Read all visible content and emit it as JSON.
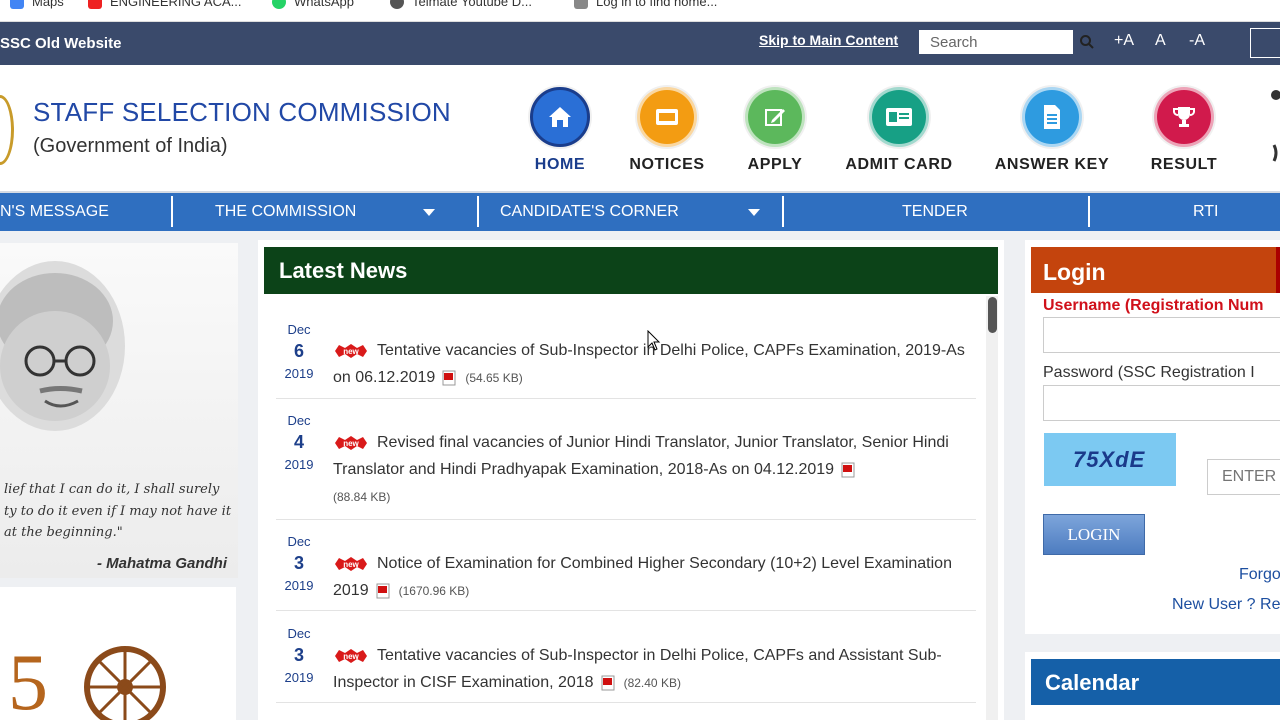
{
  "bookmarks": [
    {
      "label": "Maps",
      "color": "#4285f4"
    },
    {
      "label": "ENGINEERING ACA...",
      "color": "#e22"
    },
    {
      "label": "WhatsApp",
      "color": "#25d366"
    },
    {
      "label": "Telmate Youtube D...",
      "color": "#555"
    },
    {
      "label": "Log in to find home...",
      "color": "#888"
    }
  ],
  "topbar": {
    "old_website": "SSC Old Website",
    "skip": "Skip to Main Content",
    "search_placeholder": "Search",
    "font_increase": "+A",
    "font_normal": "A",
    "font_decrease": "-A"
  },
  "header": {
    "org_name": "STAFF SELECTION COMMISSION",
    "gov": "(Government of India)",
    "nav": [
      {
        "label": "HOME",
        "icon": "home-icon",
        "color": "#2a6fd6"
      },
      {
        "label": "NOTICES",
        "icon": "notice-icon",
        "color": "#f39c12"
      },
      {
        "label": "APPLY",
        "icon": "pencil-icon",
        "color": "#5cb85c"
      },
      {
        "label": "ADMIT CARD",
        "icon": "id-card-icon",
        "color": "#17a085"
      },
      {
        "label": "ANSWER KEY",
        "icon": "document-icon",
        "color": "#2e9be0"
      },
      {
        "label": "RESULT",
        "icon": "trophy-icon",
        "color": "#d11a4c"
      }
    ]
  },
  "mainnav": {
    "items": [
      "N'S MESSAGE",
      "THE COMMISSION",
      "CANDIDATE'S CORNER",
      "TENDER",
      "RTI"
    ]
  },
  "sidebar": {
    "quote": "lief that I can do it, I shall surely ty to do it even if I may not have it at the beginning.\"",
    "author": "- Mahatma Gandhi"
  },
  "news": {
    "title": "Latest News",
    "items": [
      {
        "month": "Dec",
        "day": "6",
        "year": "2019",
        "text": "Tentative vacancies of Sub-Inspector in Delhi Police, CAPFs Examination, 2019-As on 06.12.2019",
        "size": "(54.65 KB)"
      },
      {
        "month": "Dec",
        "day": "4",
        "year": "2019",
        "text": "Revised final vacancies of Junior Hindi Translator, Junior Translator, Senior Hindi Translator and Hindi Pradhyapak Examination, 2018-As on 04.12.2019",
        "size": "(88.84 KB)"
      },
      {
        "month": "Dec",
        "day": "3",
        "year": "2019",
        "text": "Notice of Examination for Combined Higher Secondary (10+2) Level Examination 2019",
        "size": "(1670.96 KB)"
      },
      {
        "month": "Dec",
        "day": "3",
        "year": "2019",
        "text": "Tentative vacancies of Sub-Inspector in Delhi Police, CAPFs and Assistant Sub-Inspector in CISF Examination, 2018",
        "size": "(82.40 KB)"
      }
    ]
  },
  "login": {
    "title": "Login",
    "username_label": "Username (Registration Num",
    "password_label": "Password (SSC Registration I",
    "captcha": "75XdE",
    "captcha_placeholder": "ENTER",
    "button": "LOGIN",
    "forgot": "Forgo",
    "new_user": "New User ? Re"
  },
  "calendar": {
    "title": "Calendar"
  }
}
